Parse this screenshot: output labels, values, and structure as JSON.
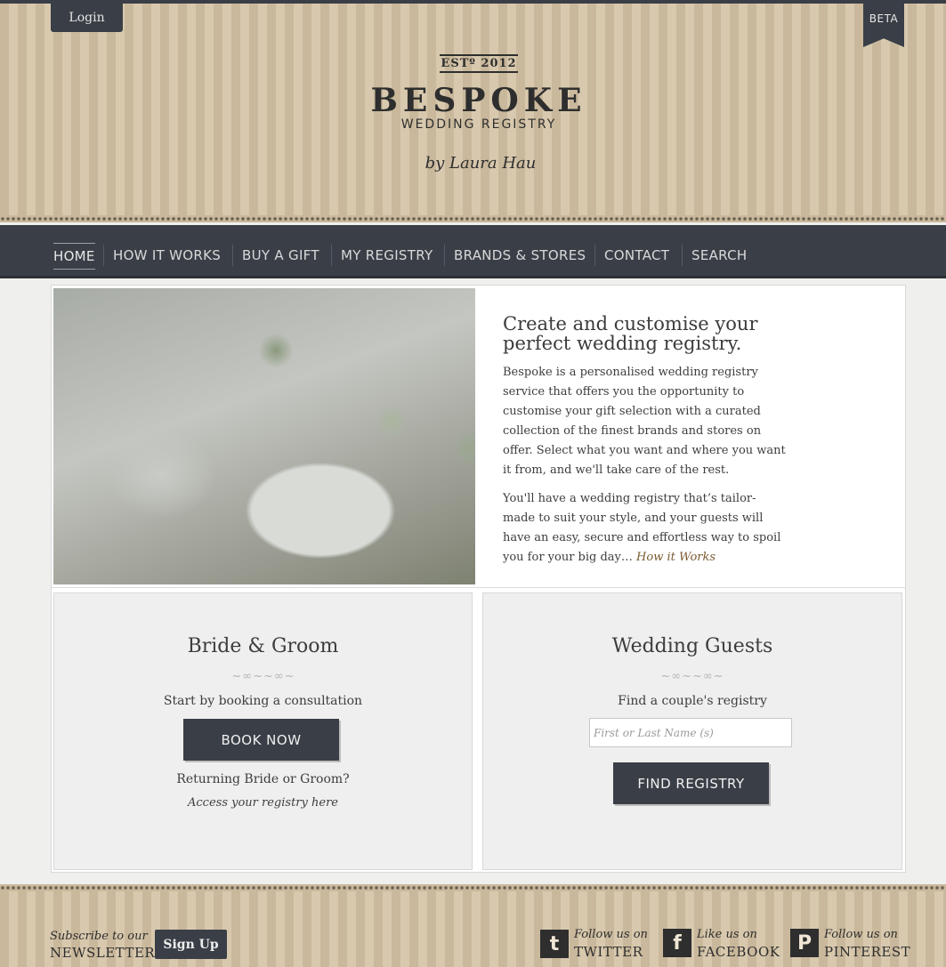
{
  "header": {
    "login_label": "Login",
    "beta_label": "BETA",
    "logo": {
      "est": "ESTº 2012",
      "name": "BESPOKE",
      "tagline": "WEDDING REGISTRY",
      "byline": "by Laura Hau"
    }
  },
  "nav": {
    "items": [
      {
        "label": "HOME",
        "active": true
      },
      {
        "label": "HOW IT WORKS"
      },
      {
        "label": "BUY A GIFT"
      },
      {
        "label": "MY REGISTRY"
      },
      {
        "label": "BRANDS & STORES"
      },
      {
        "label": "CONTACT"
      },
      {
        "label": "SEARCH"
      }
    ]
  },
  "hero": {
    "title": "Create and customise your perfect wedding registry.",
    "paragraph1": "Bespoke is a personalised wedding registry service that offers you the opportunity to customise your gift selection with a curated collection of the finest brands and stores on offer. Select what you want and where you want it from, and we'll take care of the rest.",
    "paragraph2": "You'll have a wedding registry that’s tailor-made to suit your style, and your guests will have an easy, secure and effortless way to spoil you for your big day…",
    "how_link": "How it Works"
  },
  "bride_groom": {
    "title": "Bride & Groom",
    "subtitle": "Start by booking a consultation",
    "button": "BOOK NOW",
    "returning": "Returning Bride or Groom?",
    "access_link": "Access your registry here"
  },
  "guests": {
    "title": "Wedding Guests",
    "subtitle": "Find a couple's registry",
    "input_placeholder": "First or Last Name (s)",
    "button": "FIND REGISTRY"
  },
  "footer": {
    "subscribe_small": "Subscribe to our",
    "subscribe_big": "NEWSLETTER",
    "signup_label": "Sign Up",
    "social": [
      {
        "icon": "twitter-icon",
        "glyph": "t",
        "small": "Follow us on",
        "big": "TWITTER"
      },
      {
        "icon": "facebook-icon",
        "glyph": "f",
        "small": "Like us on",
        "big": "FACEBOOK"
      },
      {
        "icon": "pinterest-icon",
        "glyph": "P",
        "small": "Follow us on",
        "big": "PINTEREST"
      }
    ]
  }
}
